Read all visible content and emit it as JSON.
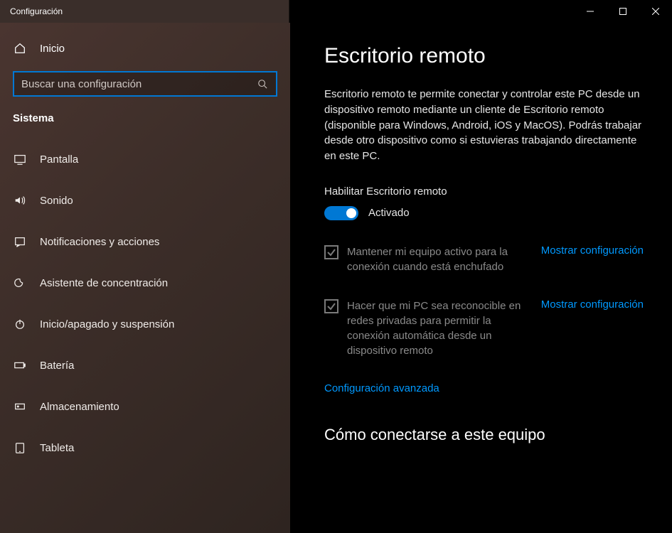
{
  "window": {
    "title": "Configuración"
  },
  "sidebar": {
    "home": "Inicio",
    "search_placeholder": "Buscar una configuración",
    "category": "Sistema",
    "items": [
      {
        "label": "Pantalla"
      },
      {
        "label": "Sonido"
      },
      {
        "label": "Notificaciones y acciones"
      },
      {
        "label": "Asistente de concentración"
      },
      {
        "label": "Inicio/apagado y suspensión"
      },
      {
        "label": "Batería"
      },
      {
        "label": "Almacenamiento"
      },
      {
        "label": "Tableta"
      }
    ]
  },
  "content": {
    "title": "Escritorio remoto",
    "intro": "Escritorio remoto te permite conectar y controlar este PC desde un dispositivo remoto mediante un cliente de Escritorio remoto (disponible para Windows, Android, iOS y MacOS). Podrás trabajar desde otro dispositivo como si estuvieras trabajando directamente en este PC.",
    "enable_label": "Habilitar Escritorio remoto",
    "toggle_state": "Activado",
    "option1": "Mantener mi equipo activo para la conexión cuando está enchufado",
    "option1_link": "Mostrar configuración",
    "option2": "Hacer que mi PC sea reconocible en redes privadas para permitir la conexión automática desde un dispositivo remoto",
    "option2_link": "Mostrar configuración",
    "advanced_link": "Configuración avanzada",
    "subheading": "Cómo conectarse a este equipo"
  }
}
